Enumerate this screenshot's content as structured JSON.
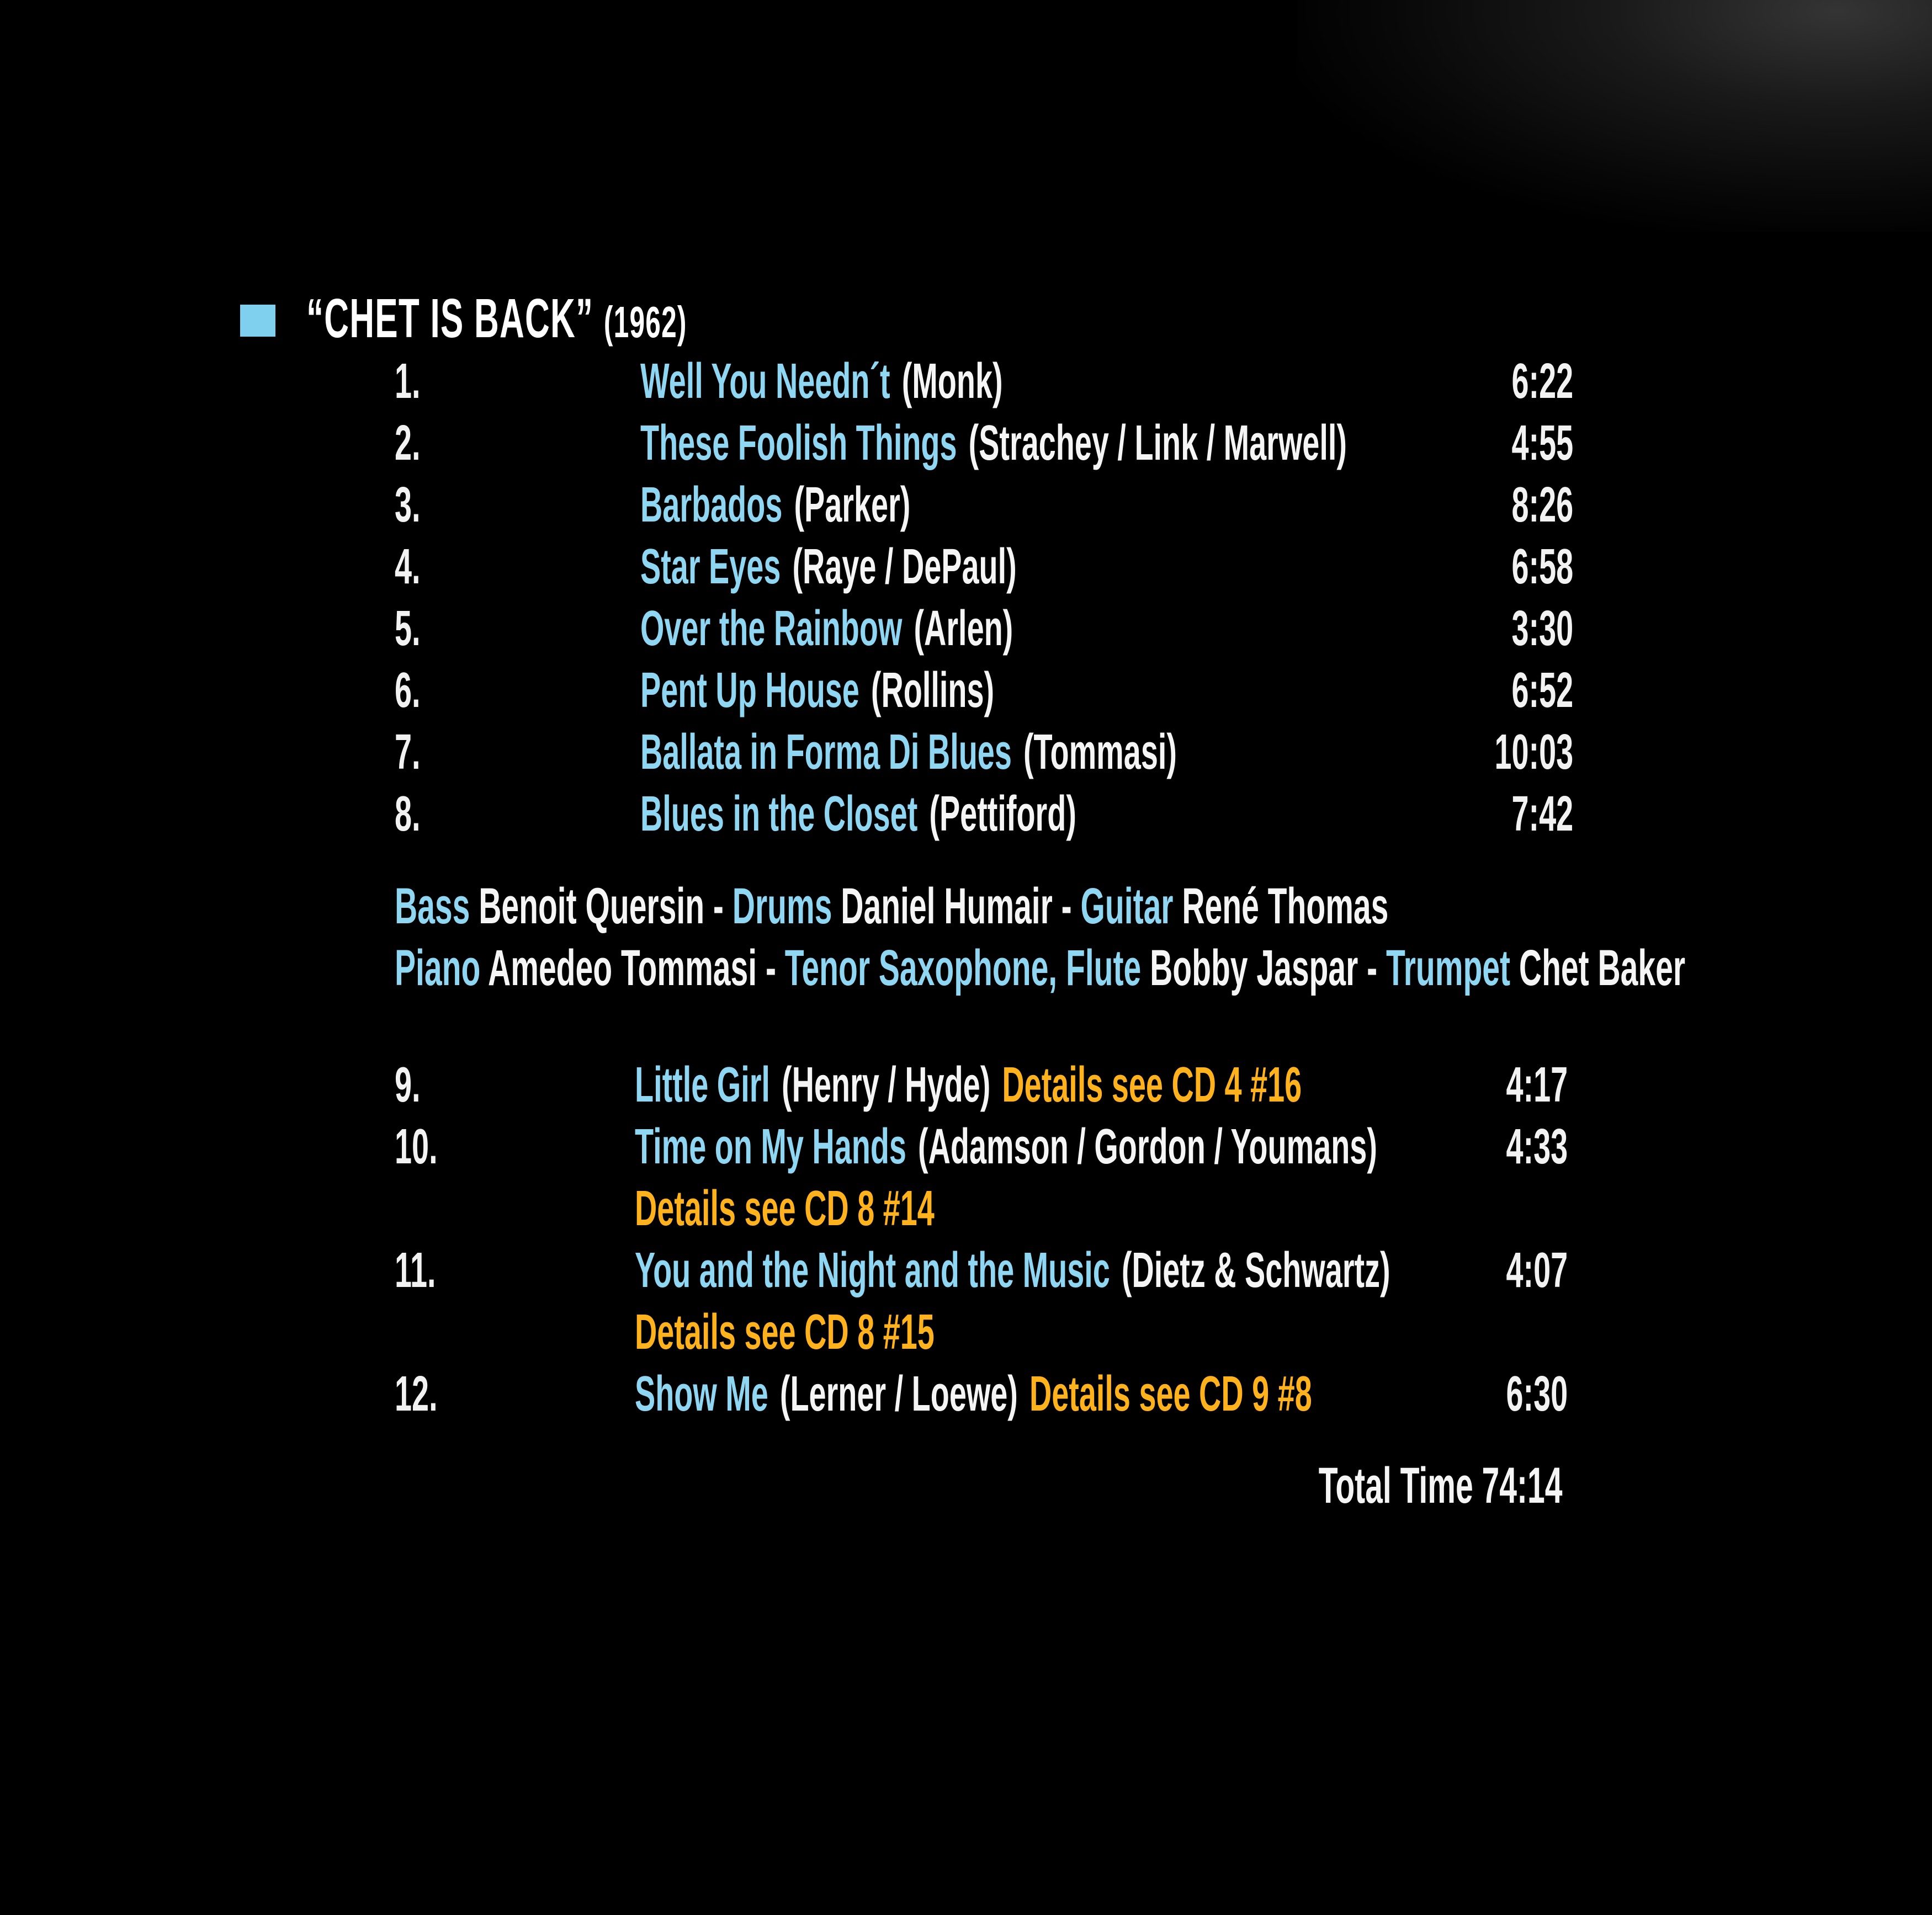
{
  "album": {
    "title": "“CHET IS BACK”",
    "year": "(1962)"
  },
  "tracks_a": [
    {
      "num": "1.",
      "title": "Well You Needn´t",
      "composer": "(Monk)",
      "time": "6:22"
    },
    {
      "num": "2.",
      "title": "These Foolish Things",
      "composer": "(Strachey / Link / Marwell)",
      "time": "4:55"
    },
    {
      "num": "3.",
      "title": "Barbados",
      "composer": "(Parker)",
      "time": "8:26"
    },
    {
      "num": "4.",
      "title": "Star Eyes",
      "composer": "(Raye / DePaul)",
      "time": "6:58"
    },
    {
      "num": "5.",
      "title": "Over the Rainbow",
      "composer": "(Arlen)",
      "time": "3:30"
    },
    {
      "num": "6.",
      "title": "Pent Up House",
      "composer": "(Rollins)",
      "time": "6:52"
    },
    {
      "num": "7.",
      "title": "Ballata in Forma Di Blues",
      "composer": "(Tommasi)",
      "time": "10:03"
    },
    {
      "num": "8.",
      "title": "Blues in the Closet",
      "composer": "(Pettiford)",
      "time": "7:42"
    }
  ],
  "personnel": {
    "line1": [
      {
        "role": "Bass",
        "name": "Benoit Quersin"
      },
      {
        "role": "Drums",
        "name": "Daniel Humair"
      },
      {
        "role": "Guitar",
        "name": "René Thomas"
      }
    ],
    "line2": [
      {
        "role": "Piano",
        "name": "Amedeo Tommasi"
      },
      {
        "role": "Tenor Saxophone, Flute",
        "name": "Bobby Jaspar"
      },
      {
        "role": "Trumpet",
        "name": "Chet Baker"
      }
    ],
    "separator": "-"
  },
  "tracks_b": [
    {
      "num": "9.",
      "title": "Little Girl",
      "composer": "(Henry / Hyde)",
      "details": "Details see CD 4  #16",
      "time": "4:17"
    },
    {
      "num": "10.",
      "title": "Time on My Hands",
      "composer": "(Adamson / Gordon / Youmans)",
      "details_below": "Details see CD 8  #14",
      "time": "4:33"
    },
    {
      "num": "11.",
      "title": "You and the Night and the Music",
      "composer": "(Dietz & Schwartz)",
      "details_below": "Details see CD 8  #15",
      "time": "4:07"
    },
    {
      "num": "12.",
      "title": "Show Me",
      "composer": "(Lerner / Loewe)",
      "details": "Details see CD 9  #8",
      "time": "6:30"
    }
  ],
  "total_time": "Total Time 74:14",
  "colors": {
    "title": "#8fd6f2",
    "details": "#ffb21c",
    "text": "#f5f5f5",
    "background": "#000000"
  }
}
